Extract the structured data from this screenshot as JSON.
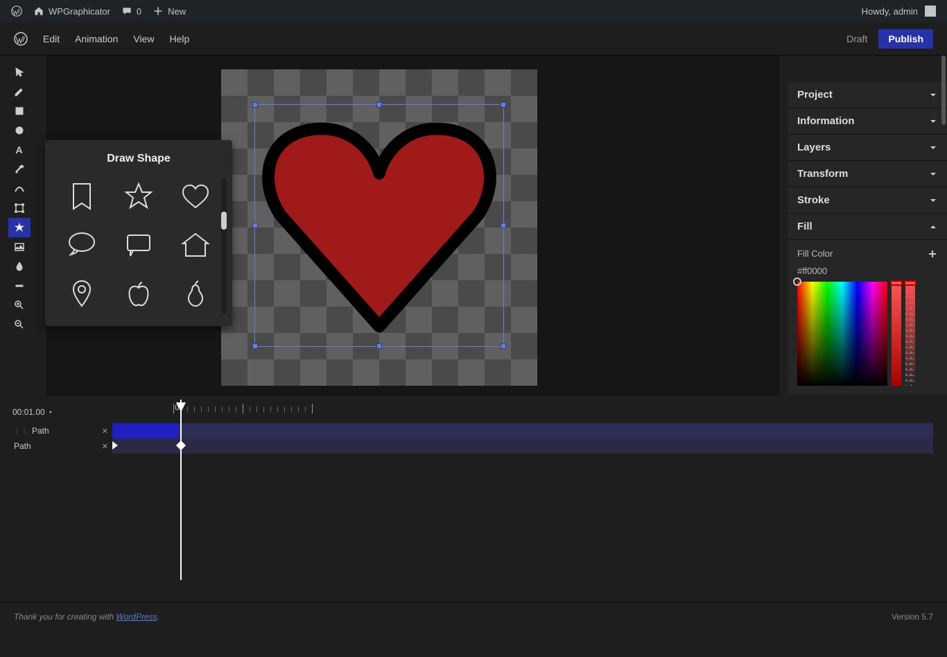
{
  "wpbar": {
    "site": "WPGraphicator",
    "comments": "0",
    "new": "New",
    "howdy": "Howdy, admin"
  },
  "menu": {
    "edit": "Edit",
    "animation": "Animation",
    "view": "View",
    "help": "Help",
    "draft": "Draft",
    "publish": "Publish"
  },
  "shape_popup": {
    "title": "Draw Shape"
  },
  "panels": {
    "project": "Project",
    "information": "Information",
    "layers": "Layers",
    "transform": "Transform",
    "stroke": "Stroke",
    "fill": "Fill"
  },
  "fill": {
    "label": "Fill Color",
    "hex": "#ff0000"
  },
  "timeline": {
    "time": "00:01.00",
    "track1": "Path",
    "track2": "Path",
    "zero": "0"
  },
  "footer": {
    "thank": "Thank you for creating with ",
    "wp": "WordPress",
    "dot": ".",
    "version": "Version 5.7"
  }
}
